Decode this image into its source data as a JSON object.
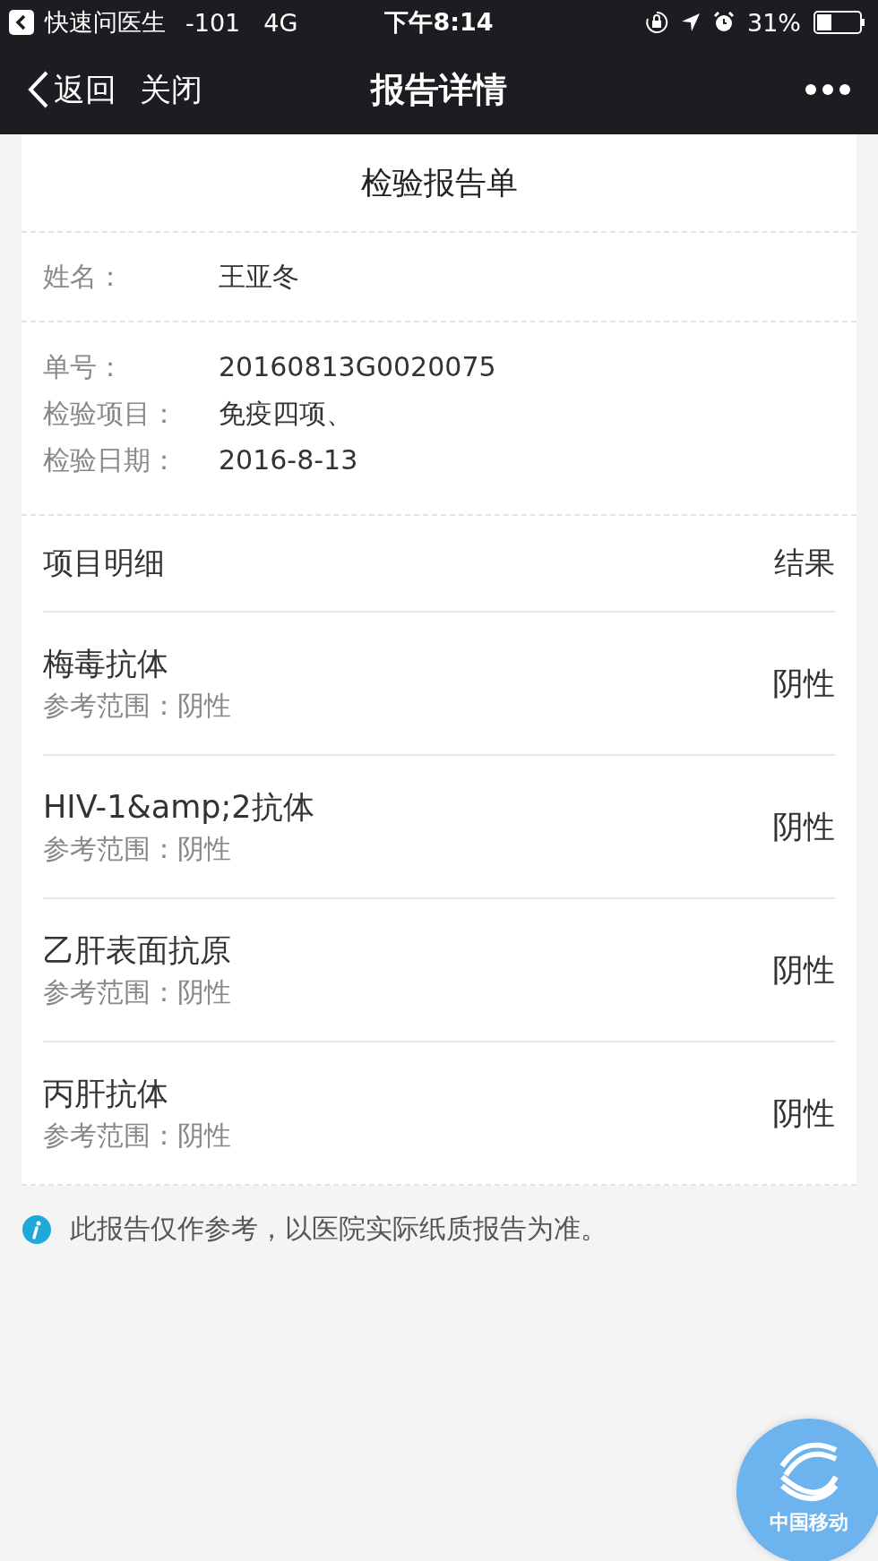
{
  "status_bar": {
    "back_app": "快速问医生",
    "signal": "-101",
    "network": "4G",
    "time": "下午8:14",
    "battery": "31%"
  },
  "nav": {
    "back": "返回",
    "close": "关闭",
    "title": "报告详情"
  },
  "report": {
    "title": "检验报告单",
    "name_label": "姓名：",
    "name": "王亚冬",
    "fields": [
      {
        "label": "单号：",
        "value": "20160813G0020075"
      },
      {
        "label": "检验项目：",
        "value": "免疫四项、"
      },
      {
        "label": "检验日期：",
        "value": "2016-8-13"
      }
    ],
    "header": {
      "item": "项目明细",
      "result": "结果"
    },
    "items": [
      {
        "name": "梅毒抗体",
        "reference": "参考范围：阴性",
        "result": "阴性"
      },
      {
        "name": "HIV-1&amp;2抗体",
        "reference": "参考范围：阴性",
        "result": "阴性"
      },
      {
        "name": "乙肝表面抗原",
        "reference": "参考范围：阴性",
        "result": "阴性"
      },
      {
        "name": "丙肝抗体",
        "reference": "参考范围：阴性",
        "result": "阴性"
      }
    ]
  },
  "note": "此报告仅作参考，以医院实际纸质报告为准。",
  "floating_button": {
    "label": "中国移动"
  }
}
